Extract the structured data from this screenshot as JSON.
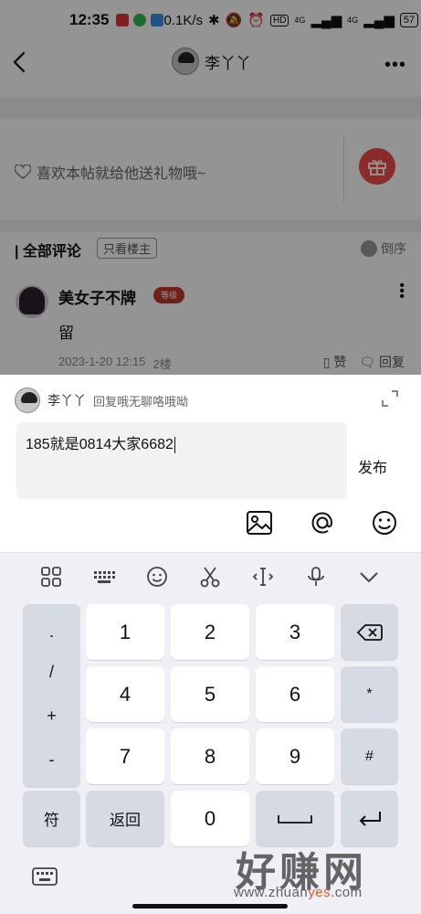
{
  "status_bar": {
    "time": "12:35",
    "network_speed": "0.1K/s",
    "signal_1": "4G",
    "signal_2": "4G",
    "hd_label": "HD",
    "battery": "57"
  },
  "nav": {
    "username": "李丫丫",
    "more_label": "•••"
  },
  "gift": {
    "text": "喜欢本帖就给他送礼物哦~"
  },
  "comments": {
    "title": "全部评论",
    "filter_label": "只看楼主",
    "sort_label": "倒序",
    "items": [
      {
        "name": "美女子不牌",
        "badge": "等级",
        "text": "留",
        "date": "2023-1-20 12:15",
        "floor": "2楼",
        "like_label": "赞",
        "reply_label": "回复"
      }
    ]
  },
  "reply": {
    "name": "李丫丫",
    "hint": "回复哦无聊咯哦呦",
    "input_value": "185就是0814大家6682",
    "publish_label": "发布"
  },
  "keyboard": {
    "side_symbols": [
      ".",
      "/",
      "+",
      "-"
    ],
    "rows": [
      [
        "1",
        "2",
        "3"
      ],
      [
        "4",
        "5",
        "6"
      ],
      [
        "7",
        "8",
        "9"
      ]
    ],
    "star": "*",
    "hash": "#",
    "symbol_key": "符",
    "back_key": "返回",
    "zero": "0"
  },
  "watermark": {
    "title": "好赚网",
    "url_prefix": "www.zhuan",
    "url_highlight": "yes",
    "url_suffix": ".com"
  },
  "colors": {
    "gift_button": "#f04a4a",
    "keyboard_bg": "#eef0f5",
    "key_dark": "#d6dae2",
    "watermark_accent": "#e05a2a"
  }
}
